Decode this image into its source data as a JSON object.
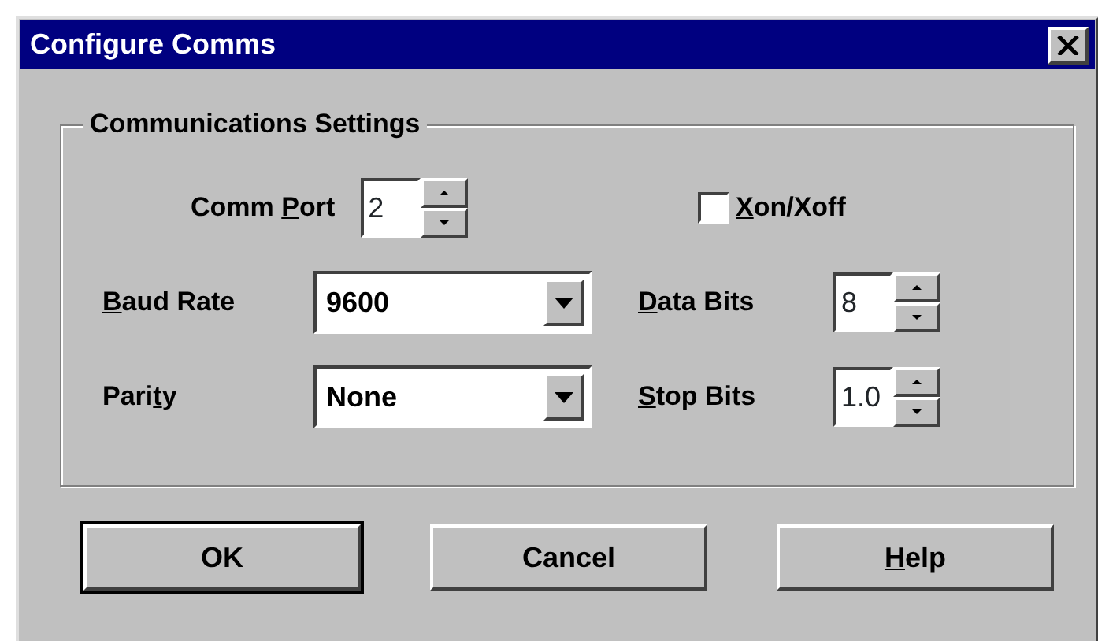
{
  "window": {
    "title": "Configure Comms"
  },
  "group": {
    "title": "Communications Settings"
  },
  "fields": [
    {
      "kind": "spin",
      "label": {
        "pre": "Comm ",
        "key": "P",
        "post": "ort"
      },
      "value": "2"
    },
    {
      "kind": "checkbox",
      "label": {
        "key": "X",
        "post": "on/Xoff"
      },
      "checked": false
    },
    {
      "kind": "combo",
      "label": {
        "key": "B",
        "post": "aud Rate"
      },
      "value": "9600"
    },
    {
      "kind": "spin",
      "label": {
        "key": "D",
        "post": "ata Bits"
      },
      "value": "8"
    },
    {
      "kind": "combo",
      "label": {
        "pre": "Pari",
        "key": "t",
        "post": "y"
      },
      "value": "None"
    },
    {
      "kind": "spin",
      "label": {
        "key": "S",
        "post": "top Bits"
      },
      "value": "1.0"
    }
  ],
  "buttons": [
    {
      "label": {
        "post": "OK"
      },
      "default": true
    },
    {
      "label": {
        "post": "Cancel"
      },
      "default": false
    },
    {
      "label": {
        "key": "H",
        "post": "elp"
      },
      "default": false
    }
  ]
}
